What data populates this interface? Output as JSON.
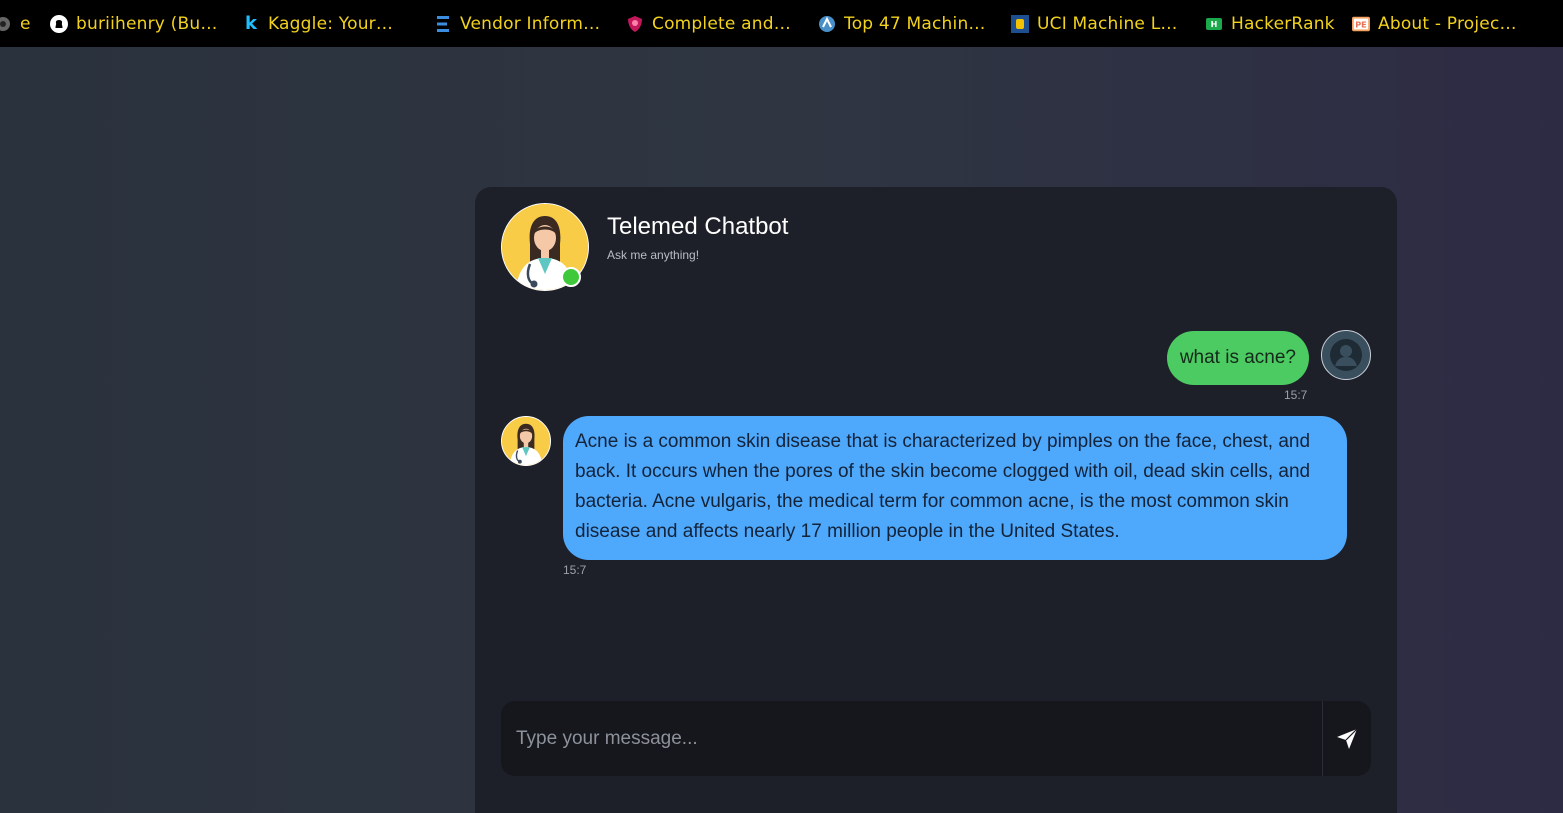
{
  "bookmarks": [
    {
      "label": "e",
      "icon": "globe-icon"
    },
    {
      "label": "buriihenry (Bu…",
      "icon": "github-icon"
    },
    {
      "label": "Kaggle: Your…",
      "icon": "kaggle-icon"
    },
    {
      "label": "Vendor Inform…",
      "icon": "vendor-icon"
    },
    {
      "label": "Complete and…",
      "icon": "shield-icon"
    },
    {
      "label": "Top 47 Machin…",
      "icon": "globe-icon"
    },
    {
      "label": "UCI Machine L…",
      "icon": "uci-icon"
    },
    {
      "label": "HackerRank",
      "icon": "hackerrank-icon"
    },
    {
      "label": "About - Projec…",
      "icon": "pe-icon"
    }
  ],
  "chat": {
    "title": "Telemed Chatbot",
    "subtitle": "Ask me anything!",
    "messages": [
      {
        "sender": "user",
        "text": "what is acne?",
        "time": "15:7"
      },
      {
        "sender": "bot",
        "text": "Acne is a common skin disease that is characterized by pimples on the face, chest, and back. It occurs when the pores of the skin become clogged with oil, dead skin cells, and bacteria. Acne vulgaris, the medical term for common acne, is the most common skin disease and affects nearly 17 million people in the United States.",
        "time": "15:7"
      }
    ],
    "input": {
      "placeholder": "Type your message...",
      "value": ""
    }
  },
  "colors": {
    "user_bubble": "#4ccb62",
    "bot_bubble": "#4ea8fb",
    "online": "#3fc93a",
    "avatar_bg": "#f9cc47",
    "bookmark_text": "#f2d21c"
  }
}
